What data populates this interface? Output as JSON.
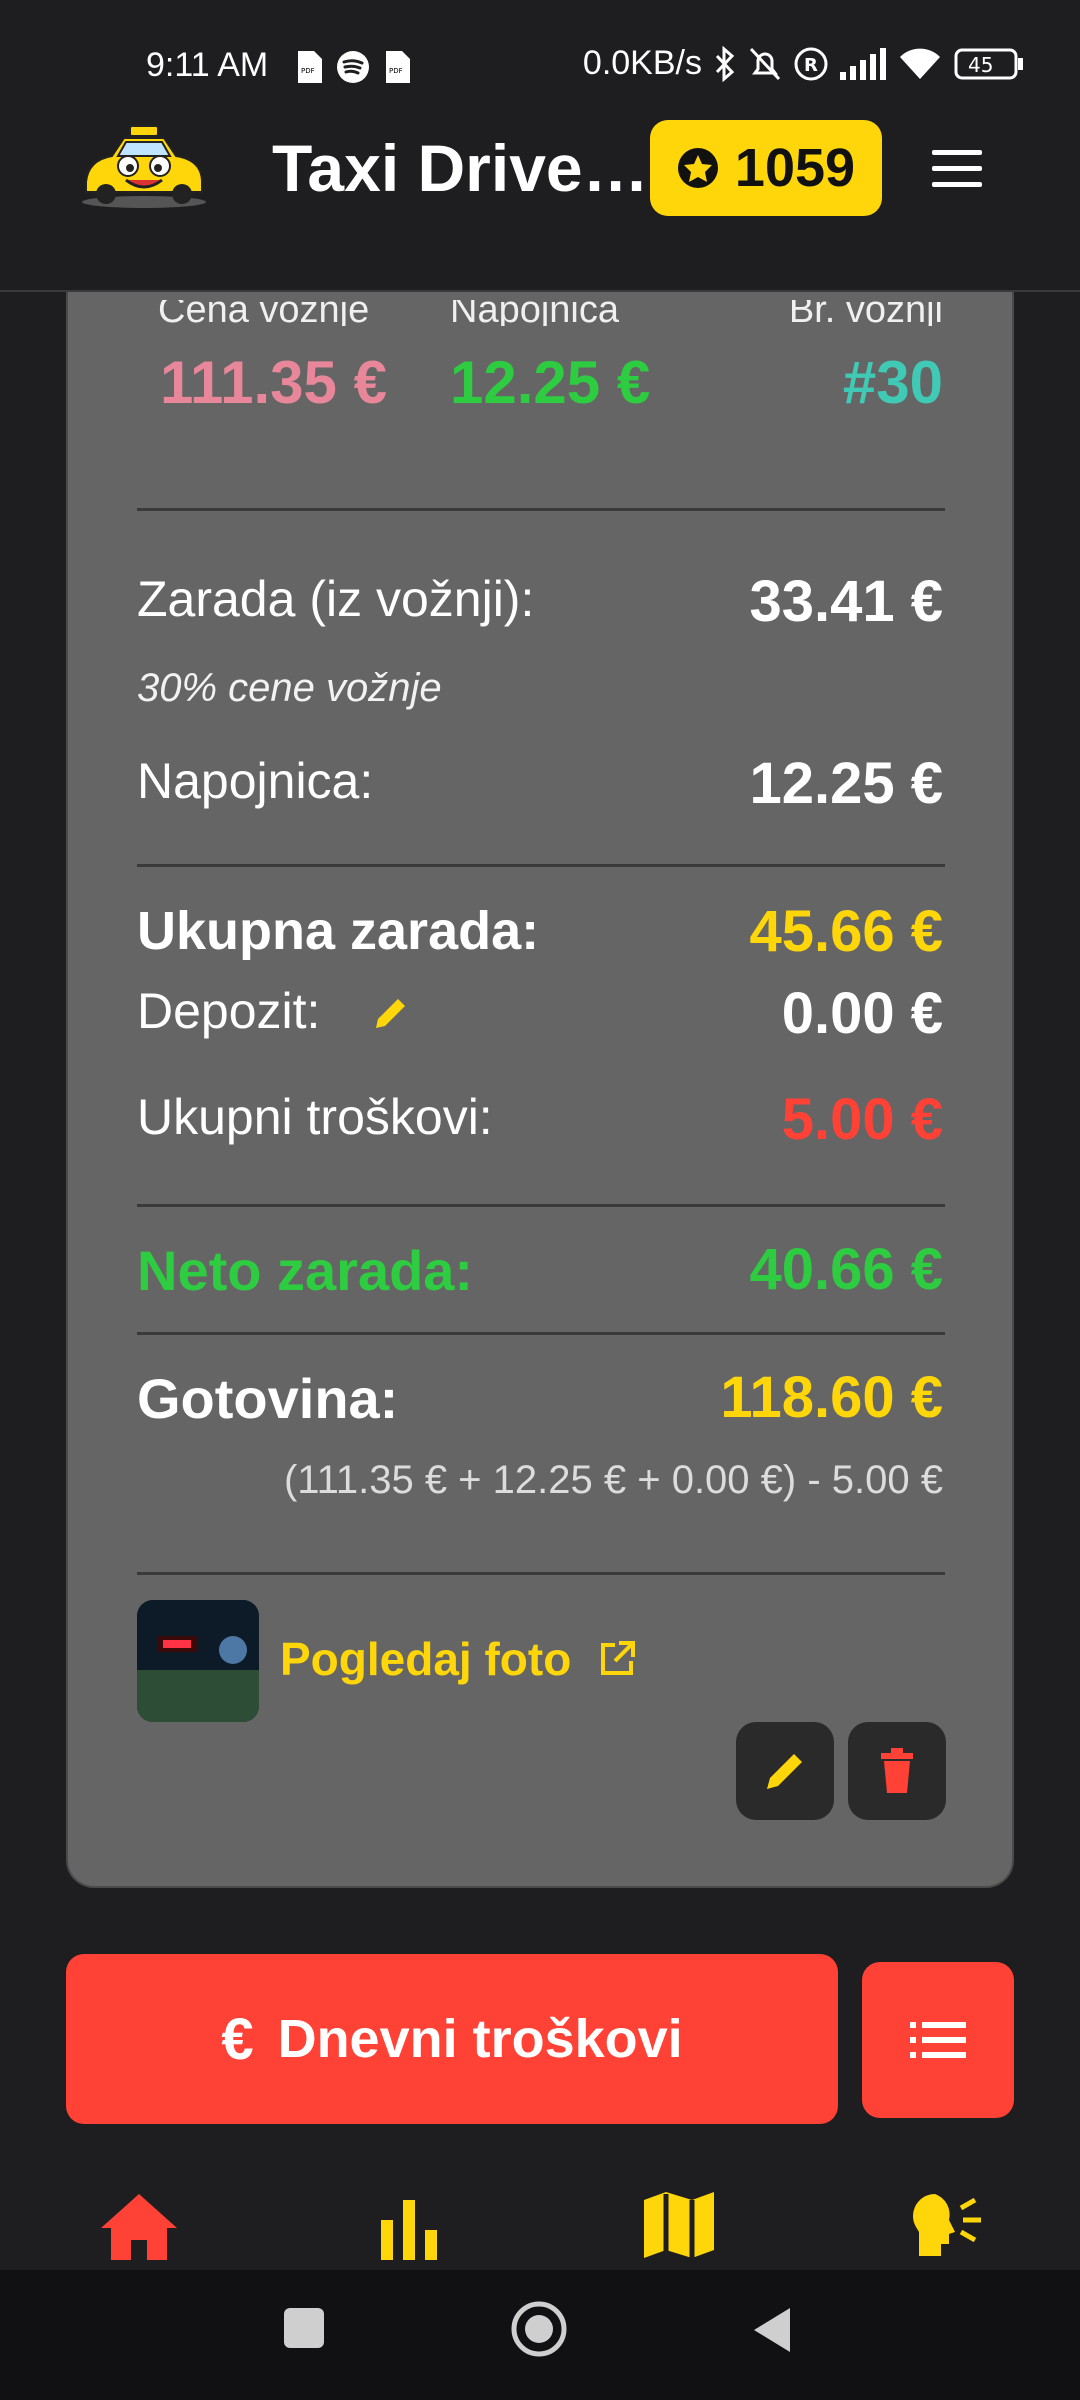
{
  "status_bar": {
    "time": "9:11 AM",
    "network_speed": "0.0KB/s",
    "battery": "45",
    "icons": [
      "pdf-icon",
      "spotify-icon",
      "pdf-icon",
      "bluetooth-icon",
      "bell-muted-icon",
      "registered-icon",
      "signal-icon",
      "wifi-icon",
      "battery-icon"
    ]
  },
  "header": {
    "title": "Taxi Driver...",
    "coins": "1059",
    "logo": "taxi-mascot-logo",
    "menu_icon": "hamburger-menu-icon"
  },
  "ride_summary": {
    "columns": [
      {
        "label": "Cena vožnje",
        "value": "111.35 €"
      },
      {
        "label": "Napojnica",
        "value": "12.25 €"
      },
      {
        "label": "Br. vožnji",
        "value": "#30"
      }
    ]
  },
  "earnings": {
    "ride_earnings_label": "Zarada (iz vožnji):",
    "ride_earnings_value": "33.41 €",
    "ride_earnings_note": "30% cene vožnje",
    "tip_label": "Napojnica:",
    "tip_value": "12.25 €",
    "total_label": "Ukupna zarada:",
    "total_value": "45.66 €",
    "deposit_label": "Depozit:",
    "deposit_value": "0.00 €",
    "expenses_label": "Ukupni troškovi:",
    "expenses_value": "5.00 €",
    "net_label": "Neto zarada:",
    "net_value": "40.66 €",
    "cash_label": "Gotovina:",
    "cash_value": "118.60 €",
    "cash_formula": "(111.35 € + 12.25 € + 0.00 €) - 5.00 €"
  },
  "photo": {
    "link_label": "Pogledaj foto"
  },
  "actions": {
    "daily_expenses_label": "Dnevni troškovi",
    "currency_symbol": "€"
  },
  "colors": {
    "accent_yellow": "#ffd60a",
    "red": "#ff4136",
    "green": "#2ecc40",
    "pink": "#e8879a",
    "teal": "#40c9b5",
    "card_bg": "#656565"
  },
  "bottom_nav": [
    "home-icon",
    "stats-icon",
    "map-icon",
    "voice-icon"
  ]
}
